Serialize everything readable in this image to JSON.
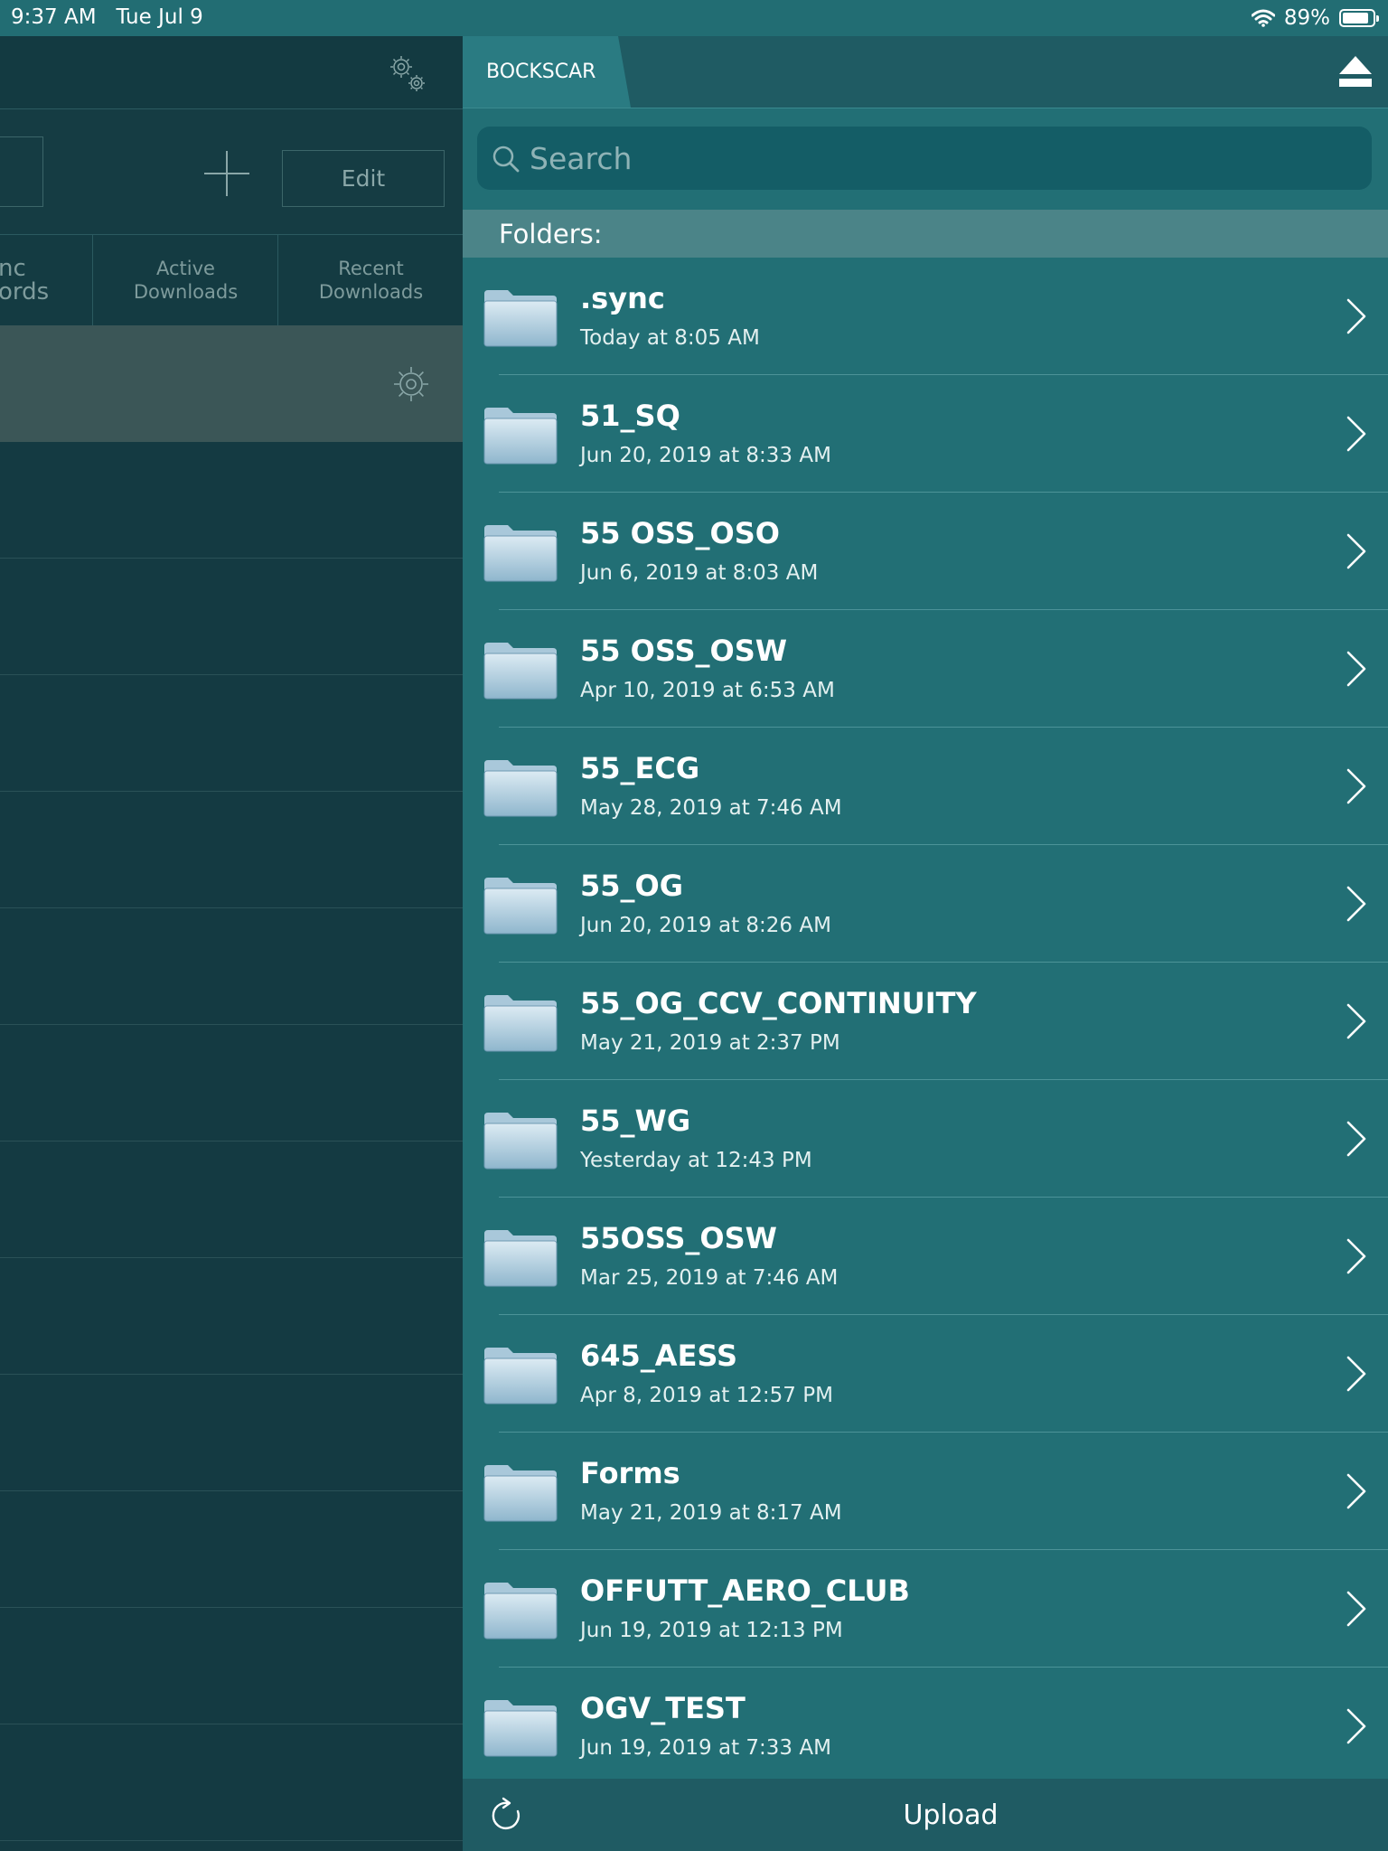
{
  "status_bar": {
    "time": "9:37 AM",
    "date": "Tue Jul 9",
    "battery": "89%",
    "battery_level": 0.89
  },
  "left_pane": {
    "edit_label": "Edit",
    "tabs": [
      {
        "line1": "nc",
        "line2": "ords"
      },
      {
        "line1": "Active",
        "line2": "Downloads"
      },
      {
        "line1": "Recent",
        "line2": "Downloads"
      }
    ]
  },
  "right_pane": {
    "server_tab": "BOCKSCAR",
    "search": {
      "placeholder": "Search",
      "value": ""
    },
    "section_header": "Folders:",
    "folders": [
      {
        "name": ".sync",
        "date": "Today at 8:05 AM"
      },
      {
        "name": "51_SQ",
        "date": "Jun 20, 2019 at 8:33 AM"
      },
      {
        "name": "55 OSS_OSO",
        "date": "Jun 6, 2019 at 8:03 AM"
      },
      {
        "name": "55 OSS_OSW",
        "date": "Apr 10, 2019 at 6:53 AM"
      },
      {
        "name": "55_ECG",
        "date": "May 28, 2019 at 7:46 AM"
      },
      {
        "name": "55_OG",
        "date": "Jun 20, 2019 at 8:26 AM"
      },
      {
        "name": "55_OG_CCV_CONTINUITY",
        "date": "May 21, 2019 at 2:37 PM"
      },
      {
        "name": "55_WG",
        "date": "Yesterday at 12:43 PM"
      },
      {
        "name": "55OSS_OSW",
        "date": "Mar 25, 2019 at 7:46 AM"
      },
      {
        "name": "645_AESS",
        "date": "Apr 8, 2019 at 12:57 PM"
      },
      {
        "name": "Forms",
        "date": "May 21, 2019 at 8:17 AM"
      },
      {
        "name": "OFFUTT_AERO_CLUB",
        "date": "Jun 19, 2019 at 12:13 PM"
      },
      {
        "name": "OGV_TEST",
        "date": "Jun 19, 2019 at 7:33 AM"
      }
    ],
    "upload_label": "Upload"
  },
  "icons": {
    "settings": "gears-icon",
    "add": "plus-icon",
    "row_settings": "gear-icon",
    "eject": "eject-icon",
    "search": "search-icon",
    "folder": "folder-icon",
    "disclosure": "chevron-right-icon",
    "refresh": "refresh-icon",
    "wifi": "wifi-icon"
  },
  "colors": {
    "accent": "#226f75",
    "nav": "#1f5b63",
    "left_bg": "#143a42",
    "section_header": "#4b8488"
  }
}
